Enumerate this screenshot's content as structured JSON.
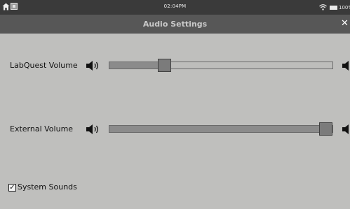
{
  "status_bar": {
    "time": "02:04PM",
    "battery": "100%",
    "icons": [
      "home-icon",
      "notification-icon",
      "wifi-icon",
      "battery-icon"
    ]
  },
  "dialog": {
    "title": "Audio Settings",
    "close_icon": "close-icon",
    "close_glyph": "✕"
  },
  "labquest_volume": {
    "label": "LabQuest Volume",
    "value_fraction": 0.23,
    "icon": "speaker-icon"
  },
  "external_volume": {
    "label": "External Volume",
    "value_fraction": 1.0,
    "icon": "speaker-icon"
  },
  "system_sounds": {
    "label": "System Sounds",
    "checked": true,
    "check_glyph": "✓"
  },
  "colors": {
    "background": "#bfbfbd",
    "status_bar": "#3a3a3a",
    "title_bar": "#575757"
  }
}
